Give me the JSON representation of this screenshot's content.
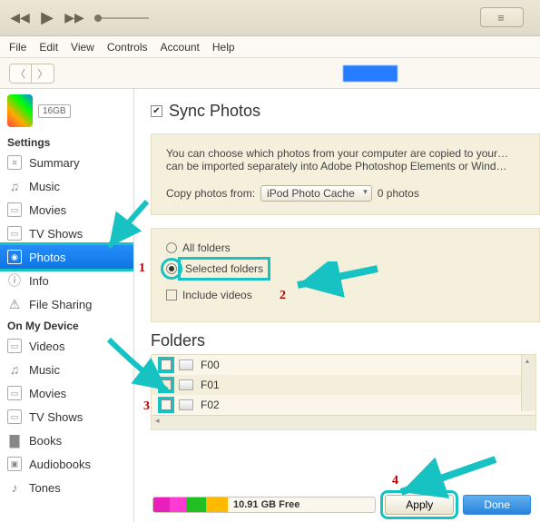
{
  "toolbar": {
    "apple_glyph": "",
    "view_glyph": "≡"
  },
  "menu": {
    "items": [
      "File",
      "Edit",
      "View",
      "Controls",
      "Account",
      "Help"
    ]
  },
  "device": {
    "capacity": "16GB"
  },
  "sidebar": {
    "sections": {
      "settings": {
        "heading": "Settings",
        "items": [
          {
            "label": "Summary",
            "icon": "≡"
          },
          {
            "label": "Music",
            "icon": "♫"
          },
          {
            "label": "Movies",
            "icon": "▭"
          },
          {
            "label": "TV Shows",
            "icon": "▭"
          },
          {
            "label": "Photos",
            "icon": "◉",
            "selected": true
          },
          {
            "label": "Info",
            "icon": "ⓘ"
          },
          {
            "label": "File Sharing",
            "icon": "⚠"
          }
        ]
      },
      "device": {
        "heading": "On My Device",
        "items": [
          {
            "label": "Videos",
            "icon": "▭"
          },
          {
            "label": "Music",
            "icon": "♫"
          },
          {
            "label": "Movies",
            "icon": "▭"
          },
          {
            "label": "TV Shows",
            "icon": "▭"
          },
          {
            "label": "Books",
            "icon": "▇"
          },
          {
            "label": "Audiobooks",
            "icon": "▣"
          },
          {
            "label": "Tones",
            "icon": "♪"
          }
        ]
      }
    }
  },
  "content": {
    "sync_label": "Sync Photos",
    "description": "You can choose which photos from your computer are copied to your… can be imported separately into Adobe Photoshop Elements or Wind…",
    "copy_from_label": "Copy photos from:",
    "copy_from_value": "iPod Photo Cache",
    "photo_count": "0 photos",
    "radio_all": "All folders",
    "radio_selected": "Selected folders",
    "include_videos": "Include videos",
    "folders_heading": "Folders",
    "folders": [
      "F00",
      "F01",
      "F02"
    ]
  },
  "footer": {
    "free_label": "10.91 GB Free",
    "apply": "Apply",
    "done": "Done",
    "segments": [
      {
        "color": "#e81fbd",
        "w": 18
      },
      {
        "color": "#ff3bd1",
        "w": 18
      },
      {
        "color": "#1fc01f",
        "w": 22
      },
      {
        "color": "#ffba00",
        "w": 24
      }
    ]
  },
  "annotations": {
    "n1": "1",
    "n2": "2",
    "n3": "3",
    "n4": "4"
  }
}
